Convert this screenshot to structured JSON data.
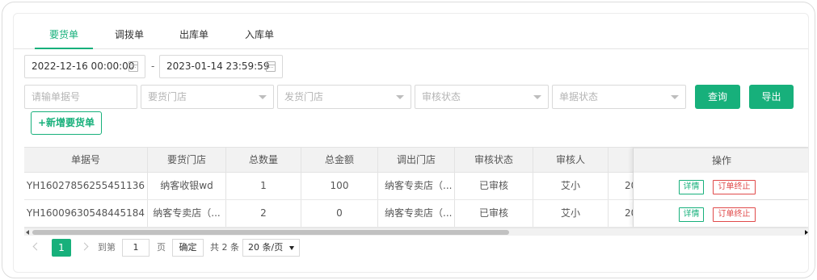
{
  "tabs": [
    {
      "label": "要货单",
      "active": true
    },
    {
      "label": "调拨单",
      "active": false
    },
    {
      "label": "出库单",
      "active": false
    },
    {
      "label": "入库单",
      "active": false
    }
  ],
  "date_range": {
    "start": "2022-12-16 00:00:00",
    "separator": "-",
    "end": "2023-01-14 23:59:59"
  },
  "filters": {
    "order_no_placeholder": "请输单据号",
    "request_store_placeholder": "要货门店",
    "ship_store_placeholder": "发货门店",
    "audit_status_placeholder": "审核状态",
    "order_status_placeholder": "单据状态"
  },
  "actions": {
    "search": "查询",
    "export": "导出",
    "new_order": "新增要货单"
  },
  "table": {
    "columns": [
      "单据号",
      "要货门店",
      "总数量",
      "总金额",
      "调出门店",
      "审核状态",
      "审核人",
      "",
      "操作"
    ],
    "rows": [
      {
        "order_no": "YH16027856255451136",
        "request_store": "纳客收银wd",
        "qty": "1",
        "amount": "100",
        "out_store": "纳客专卖店（...",
        "audit_status": "已审核",
        "auditor": "艾小",
        "date": "20"
      },
      {
        "order_no": "YH16009630548445184",
        "request_store": "纳客专卖店（...",
        "qty": "2",
        "amount": "0",
        "out_store": "纳客专卖店（...",
        "audit_status": "已审核",
        "auditor": "艾小",
        "date": "20"
      }
    ],
    "row_actions": {
      "detail": "详情",
      "terminate": "订单终止"
    }
  },
  "pagination": {
    "current_page": "1",
    "goto_label": "到第",
    "goto_value": "1",
    "page_unit": "页",
    "confirm": "确定",
    "total": "共 2 条",
    "page_size": "20 条/页"
  },
  "colors": {
    "accent": "#17b07b",
    "danger": "#e04a4a"
  },
  "icons": [
    "calendar-icon",
    "chevron-down-icon",
    "plus-icon",
    "chevron-left-icon",
    "chevron-right-icon"
  ]
}
